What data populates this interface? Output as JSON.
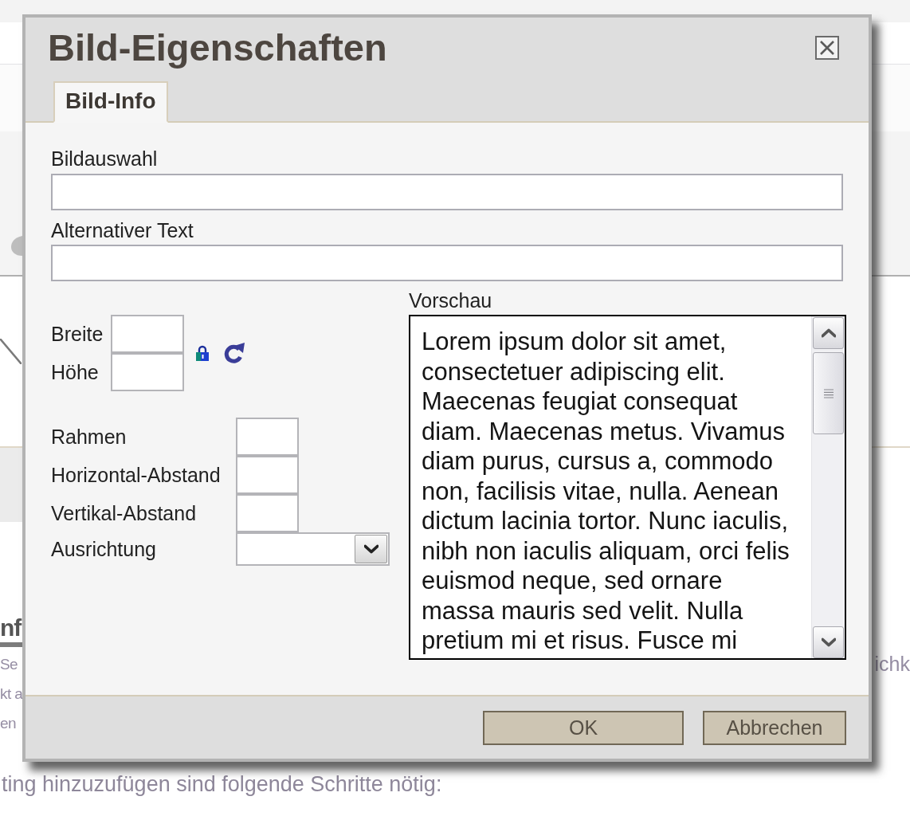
{
  "page": {
    "heading": "nf",
    "left_fragments": [
      "Se",
      "kt a",
      "en"
    ],
    "right_fragment": "ichk",
    "last_line": "ting hinzuzufügen sind folgende Schritte nötig:"
  },
  "dialog": {
    "title": "Bild-Eigenschaften",
    "tabs": [
      {
        "label": "Bild-Info",
        "selected": true
      }
    ],
    "fields": [
      {
        "label": "Bildauswahl"
      },
      {
        "label": "Alternativer Text"
      }
    ],
    "size_fields": [
      {
        "label": "Breite"
      },
      {
        "label": "Höhe"
      }
    ],
    "layout_fields": [
      {
        "label": "Rahmen",
        "kind": "text"
      },
      {
        "label": "Horizontal-Abstand",
        "kind": "text"
      },
      {
        "label": "Vertikal-Abstand",
        "kind": "text"
      },
      {
        "label": "Ausrichtung",
        "kind": "select"
      }
    ],
    "preview": {
      "label": "Vorschau",
      "lines": [
        "Lorem ipsum dolor sit amet,",
        "consectetuer adipiscing elit.",
        "Maecenas feugiat consequat",
        "diam. Maecenas metus. Vivamus",
        "diam purus, cursus a, commodo",
        "non, facilisis vitae, nulla. Aenean",
        "dictum lacinia tortor. Nunc iaculis,",
        "nibh non iaculis aliquam, orci felis",
        "euismod neque, sed ornare",
        "massa mauris sed velit. Nulla",
        "pretium mi et risus. Fusce mi"
      ]
    },
    "buttons": [
      {
        "label": "OK",
        "kind": "confirm"
      },
      {
        "label": "Abbrechen",
        "kind": "cancel"
      }
    ]
  }
}
